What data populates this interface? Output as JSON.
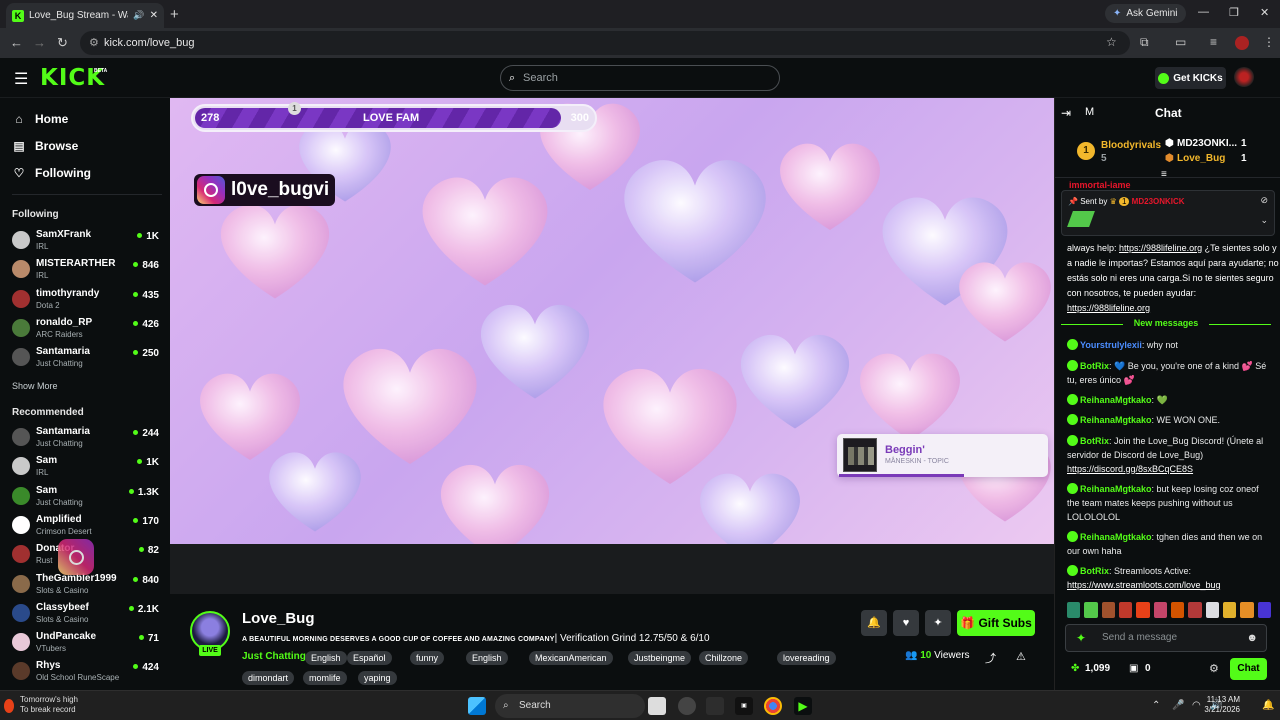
{
  "browser": {
    "tab_title": "Love_Bug Stream - Watch L",
    "new_tab": "+",
    "ask_gemini": "Ask Gemini",
    "url": "kick.com/love_bug"
  },
  "header": {
    "logo": "KICK",
    "beta": "BETA",
    "search_placeholder": "Search",
    "get_kicks": "Get KICKs"
  },
  "sidebar": {
    "nav": [
      {
        "label": "Home",
        "icon": "home-icon"
      },
      {
        "label": "Browse",
        "icon": "browse-icon"
      },
      {
        "label": "Following",
        "icon": "heart-icon"
      }
    ],
    "following_heading": "Following",
    "following": [
      {
        "name": "SamXFrank",
        "category": "IRL",
        "viewers": "1K",
        "color": "#c9c9c9"
      },
      {
        "name": "MISTERARTHER",
        "category": "IRL",
        "viewers": "846",
        "color": "#b98a6a"
      },
      {
        "name": "timothyrandy",
        "category": "Dota 2",
        "viewers": "435",
        "color": "#a03030"
      },
      {
        "name": "ronaldo_RP",
        "category": "ARC Raiders",
        "viewers": "426",
        "color": "#4a7a3a"
      },
      {
        "name": "Santamaria",
        "category": "Just Chatting",
        "viewers": "250",
        "color": "#555555"
      }
    ],
    "show_more": "Show More",
    "recommended_heading": "Recommended",
    "recommended": [
      {
        "name": "Santamaria",
        "category": "Just Chatting",
        "viewers": "244",
        "color": "#555555"
      },
      {
        "name": "Sam",
        "category": "IRL",
        "viewers": "1K",
        "color": "#c9c9c9"
      },
      {
        "name": "Sam",
        "category": "Just Chatting",
        "viewers": "1.3K",
        "color": "#3a8a2a"
      },
      {
        "name": "Amplified",
        "category": "Crimson Desert",
        "viewers": "170",
        "color": "#ffffff"
      },
      {
        "name": "Donator",
        "category": "Rust",
        "viewers": "82",
        "color": "#a03030"
      },
      {
        "name": "TheGambler1999",
        "category": "Slots & Casino",
        "viewers": "840",
        "color": "#8a6a4a"
      },
      {
        "name": "Classybeef",
        "category": "Slots & Casino",
        "viewers": "2.1K",
        "color": "#2a4a8a"
      },
      {
        "name": "UndPancake",
        "category": "VTubers",
        "viewers": "71",
        "color": "#e8c8d8"
      },
      {
        "name": "Rhys",
        "category": "Old School RuneScape",
        "viewers": "424",
        "color": "#5a3a2a"
      }
    ]
  },
  "player": {
    "progress_min": "278",
    "progress_title": "LOVE FAM",
    "progress_max": "300",
    "progress_marker": "1",
    "progress_fraction": 0.92,
    "instagram_handle": "l0ve_bugvi",
    "now_playing_song": "Beggin'",
    "now_playing_artist": "MÅNESKIN - TOPIC"
  },
  "stream": {
    "streamer": "Love_Bug",
    "live_badge": "LIVE",
    "title_fancy": "A BEAUTIFUL MORNING DESERVES A GOOD CUP OF COFFEE AND AMAZING COMPANY",
    "title_rest": "| Verification Grind 12.75/50 & 6/10",
    "category": "Just Chatting",
    "tags": [
      "English",
      "Español",
      "funny",
      "English",
      "MexicanAmerican",
      "Justbeingme",
      "Chillzone",
      "lovereading",
      "dimondart",
      "momlife",
      "yaping"
    ],
    "gift_subs": "Gift Subs",
    "viewers_count": "10",
    "viewers_label": "Viewers"
  },
  "chat": {
    "mode_label": "M",
    "title": "Chat",
    "leaderboard": {
      "first_rank": "1",
      "first_name": "Bloodyrivals",
      "first_count": "5",
      "second_name": "MD23ONKI...",
      "second_count": "1",
      "third_name": "Love_Bug",
      "third_count": "1"
    },
    "partial_user": "immortal-jame",
    "pinned_sent_by": "Sent by",
    "pinned_badge": "1",
    "pinned_user": "MD23ONKICK",
    "pinned_text_1": "always help: ",
    "pinned_link_1": "https://988lifeline.org",
    "pinned_text_2": " ¿Te sientes solo y a nadie le importas? Estamos aquí para ayudarte; no estás solo ni eres una carga.Si no te sientes seguro con nosotros, te pueden ayudar: ",
    "pinned_link_2": "https://988lifeline.org",
    "new_messages": "New messages",
    "messages": [
      {
        "user": "Yourstrulylexii",
        "color": "#4b8dff",
        "text": "why not"
      },
      {
        "user": "BotRix",
        "color": "#53fc18",
        "text": "💙 Be you, you're one of a kind 💕 Sé tu, eres único 💕"
      },
      {
        "user": "ReihanaMgtkako",
        "color": "#53fc18",
        "text": "💚"
      },
      {
        "user": "ReihanaMgtkako",
        "color": "#53fc18",
        "text": "WE WON ONE."
      },
      {
        "user": "BotRix",
        "color": "#53fc18",
        "text": "Join the Love_Bug Discord! (Únete al servidor de Discord de Love_Bug) ",
        "link": "https://discord.gg/8sxBCqCE8S"
      },
      {
        "user": "ReihanaMgtkako",
        "color": "#53fc18",
        "text": "but keep losing coz oneof the team mates keeps pushing without us LOLOLOLOL"
      },
      {
        "user": "ReihanaMgtkako",
        "color": "#53fc18",
        "text": "tghen dies and then we on our own haha"
      },
      {
        "user": "BotRix",
        "color": "#53fc18",
        "text": "Streamloots Active: ",
        "link": "https://www.streamloots.com/love_bug"
      }
    ],
    "input_placeholder": "Send a message",
    "points": "1,099",
    "chest_count": "0",
    "chat_button": "Chat"
  },
  "taskbar": {
    "weather_line1": "Tomorrow's high",
    "weather_line2": "To break record",
    "search": "Search",
    "time": "11:13 AM",
    "date": "3/21/2026"
  }
}
